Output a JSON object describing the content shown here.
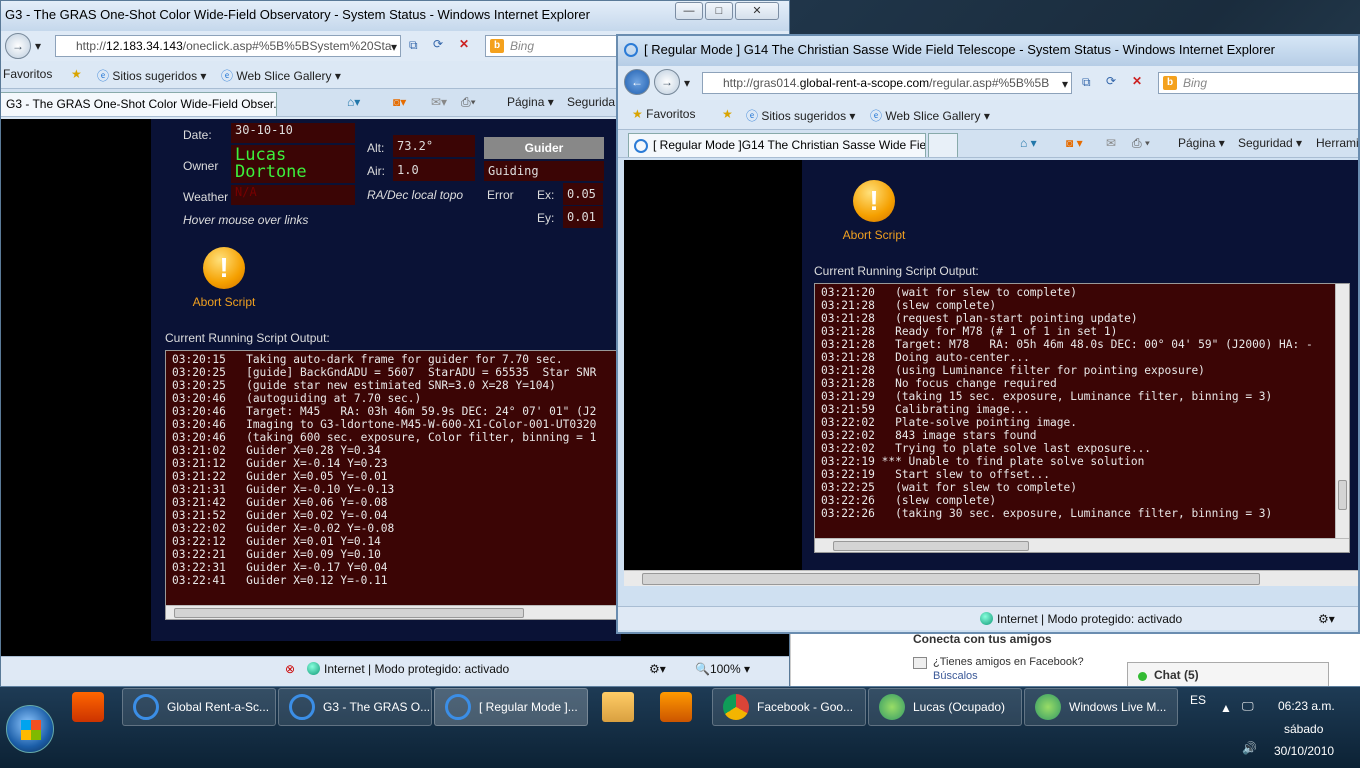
{
  "win1": {
    "title": "G3 - The GRAS One-Shot Color Wide-Field Observatory - System Status - Windows Internet Explorer",
    "url_prefix": "http://",
    "url_host": "12.183.34.143",
    "url_rest": "/oneclick.asp#%5B%5BSystem%20Sta",
    "search_placeholder": "Bing",
    "fav_label": "Favoritos",
    "fav_sites": "Sitios sugeridos ▾",
    "fav_slice": "Web Slice Gallery ▾",
    "tab_label": "G3 - The GRAS One-Shot Color Wide-Field Obser...",
    "cmd_page": "Página ▾",
    "cmd_security": "Segurida",
    "status": "Internet | Modo protegido: activado",
    "zoom": "100%",
    "date_label": "Date:",
    "date_value": "30-10-10",
    "owner_label": "Owner",
    "owner_value": "Lucas Dortone",
    "weather_label": "Weather",
    "weather_value": "N/A",
    "hover_hint": "Hover mouse over links",
    "alt_label": "Alt:",
    "alt_value": "73.2°",
    "air_label": "Air:",
    "air_value": "1.0",
    "radec_label": "RA/Dec local topo",
    "guider_header": "Guider",
    "guider_status": "Guiding",
    "error_label": "Error",
    "ex_label": "Ex:",
    "ex_value": "0.05",
    "ey_label": "Ey:",
    "ey_value": "0.01",
    "abort_label": "Abort Script",
    "output_title": "Current Running Script Output:",
    "log": [
      "03:20:15   Taking auto-dark frame for guider for 7.70 sec.",
      "03:20:25   [guide] BackGndADU = 5607  StarADU = 65535  Star SNR",
      "03:20:25   (guide star new estimiated SNR=3.0 X=28 Y=104)",
      "03:20:46   (autoguiding at 7.70 sec.)",
      "03:20:46   Target: M45   RA: 03h 46m 59.9s DEC: 24° 07' 01\" (J2",
      "03:20:46   Imaging to G3-ldortone-M45-W-600-X1-Color-001-UT0320",
      "03:20:46   (taking 600 sec. exposure, Color filter, binning = 1",
      "03:21:02   Guider X=0.28 Y=0.34",
      "03:21:12   Guider X=-0.14 Y=0.23",
      "03:21:22   Guider X=0.05 Y=-0.01",
      "03:21:31   Guider X=-0.10 Y=-0.13",
      "03:21:42   Guider X=0.06 Y=-0.08",
      "03:21:52   Guider X=0.02 Y=-0.04",
      "03:22:02   Guider X=-0.02 Y=-0.08",
      "03:22:12   Guider X=0.01 Y=0.14",
      "03:22:21   Guider X=0.09 Y=0.10",
      "03:22:31   Guider X=-0.17 Y=0.04",
      "03:22:41   Guider X=0.12 Y=-0.11"
    ]
  },
  "win2": {
    "title": "[ Regular Mode ]  G14 The Christian Sasse Wide Field Telescope - System Status - Windows Internet Explorer",
    "url_prefix": "http://gras014.",
    "url_host": "global-rent-a-scope.com",
    "url_rest": "/regular.asp#%5B%5B",
    "search_placeholder": "Bing",
    "fav_label": "Favoritos",
    "fav_sites": "Sitios sugeridos ▾",
    "fav_slice": "Web Slice Gallery ▾",
    "tab_label": "[ Regular Mode ]G14 The Christian Sasse Wide Fie...",
    "cmd_page": "Página ▾",
    "cmd_security": "Seguridad ▾",
    "cmd_tools": "Herrami",
    "status": "Internet | Modo protegido: activado",
    "abort_label": "Abort Script",
    "output_title": "Current Running Script Output:",
    "log": [
      "03:21:20   (wait for slew to complete)",
      "03:21:28   (slew complete)",
      "03:21:28   (request plan-start pointing update)",
      "03:21:28   Ready for M78 (# 1 of 1 in set 1)",
      "03:21:28   Target: M78   RA: 05h 46m 48.0s DEC: 00° 04' 59\" (J2000) HA: -",
      "03:21:28   Doing auto-center...",
      "03:21:28   (using Luminance filter for pointing exposure)",
      "03:21:28   No focus change required",
      "03:21:29   (taking 15 sec. exposure, Luminance filter, binning = 3)",
      "03:21:59   Calibrating image...",
      "03:22:02   Plate-solve pointing image.",
      "03:22:02   843 image stars found",
      "03:22:02   Trying to plate solve last exposure...",
      "03:22:19 *** Unable to find plate solve solution",
      "03:22:19   Start slew to offset...",
      "03:22:25   (wait for slew to complete)",
      "03:22:26   (slew complete)",
      "03:22:26   (taking 30 sec. exposure, Luminance filter, binning = 3)"
    ]
  },
  "background": {
    "connect": "Conecta con tus amigos",
    "fb_question": "¿Tienes amigos en Facebook?",
    "fb_search": "Búscalos",
    "chat": "Chat (5)"
  },
  "taskbar": {
    "items": [
      "Global Rent-a-Sc...",
      "G3 - The GRAS O...",
      "[ Regular Mode ]...",
      "Facebook - Goo...",
      "Lucas (Ocupado)",
      "Windows Live M..."
    ],
    "lang": "ES",
    "time": "06:23 a.m.",
    "day": "sábado",
    "date": "30/10/2010"
  },
  "colors": {
    "owner_green": "#3cf03c",
    "log_bg": "#3b0505",
    "panel_bg": "#0a1236",
    "abort_orange": "#f0a020"
  }
}
